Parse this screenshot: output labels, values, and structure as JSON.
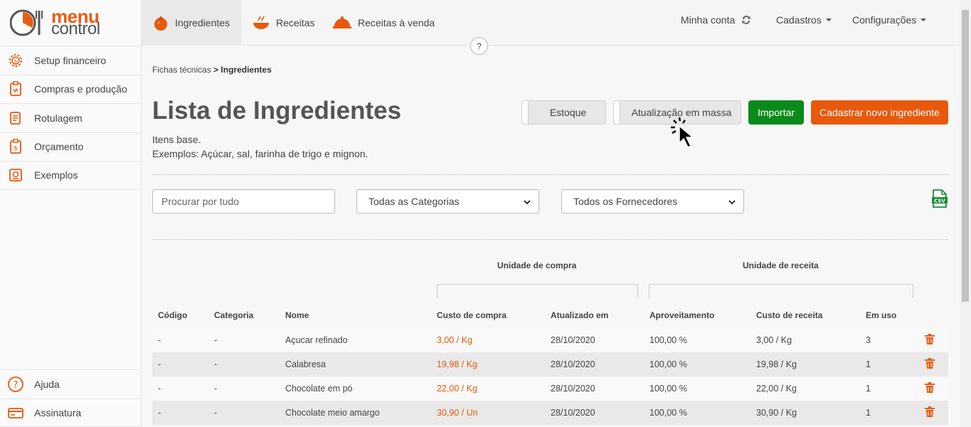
{
  "brand": {
    "line1": "menu",
    "line2": "control"
  },
  "sidebar": {
    "items": [
      {
        "label": "Setup financeiro",
        "icon": "gear-dollar-icon"
      },
      {
        "label": "Compras e produção",
        "icon": "shopping-list-icon"
      },
      {
        "label": "Rotulagem",
        "icon": "label-icon"
      },
      {
        "label": "Orçamento",
        "icon": "budget-icon"
      },
      {
        "label": "Exemplos",
        "icon": "examples-icon"
      }
    ],
    "bottom": [
      {
        "label": "Ajuda",
        "icon": "help-icon"
      },
      {
        "label": "Assinatura",
        "icon": "credit-card-icon"
      }
    ]
  },
  "topnav": {
    "tabs": [
      {
        "label": "Ingredientes",
        "icon": "tomato-icon",
        "active": true
      },
      {
        "label": "Receitas",
        "icon": "bowl-icon"
      },
      {
        "label": "Receitas à venda",
        "icon": "cloche-icon"
      }
    ],
    "account": "Minha conta",
    "cadastros": "Cadastros",
    "configuracoes": "Configurações",
    "help": "?"
  },
  "breadcrumb": {
    "parent": "Fichas técnicas",
    "sep": ">",
    "current": "Ingredientes"
  },
  "page": {
    "title": "Lista de Ingredientes",
    "line1": "Itens base.",
    "line2": "Exemplos: Açúcar, sal, farinha de trigo e mignon."
  },
  "buttons": {
    "estoque": "Estoque",
    "massa": "Atualização em massa",
    "importar": "Importar",
    "novo": "Cadastrar novo ingrediente"
  },
  "filters": {
    "search_placeholder": "Procurar por tudo",
    "categoria": "Todas as Categorias",
    "fornecedor": "Todos os Fornecedores"
  },
  "table": {
    "group_compra": "Unidade de compra",
    "group_receita": "Unidade de receita",
    "headers": [
      "Código",
      "Categoria",
      "Nome",
      "Custo de compra",
      "Atualizado em",
      "Aproveitamento",
      "Custo de receita",
      "Em uso"
    ],
    "rows": [
      {
        "codigo": "-",
        "categoria": "-",
        "nome": "Açucar refinado",
        "custo_compra": "3,00 / Kg",
        "atualizado": "28/10/2020",
        "aproveitamento": "100,00 %",
        "custo_receita": "3,00 / Kg",
        "em_uso": "3"
      },
      {
        "codigo": "-",
        "categoria": "-",
        "nome": "Calabresa",
        "custo_compra": "19,98 / Kg",
        "atualizado": "28/10/2020",
        "aproveitamento": "100,00 %",
        "custo_receita": "19,98 / Kg",
        "em_uso": "1"
      },
      {
        "codigo": "-",
        "categoria": "-",
        "nome": "Chocolate em pó",
        "custo_compra": "22,00 / Kg",
        "atualizado": "28/10/2020",
        "aproveitamento": "100,00 %",
        "custo_receita": "22,00 / Kg",
        "em_uso": "1"
      },
      {
        "codigo": "-",
        "categoria": "-",
        "nome": "Chocolate meio amargo",
        "custo_compra": "30,90 / Un",
        "atualizado": "28/10/2020",
        "aproveitamento": "100,00 %",
        "custo_receita": "30,90 / Kg",
        "em_uso": "1"
      }
    ]
  },
  "colors": {
    "accent": "#e8590c",
    "green": "#0a8a19"
  }
}
